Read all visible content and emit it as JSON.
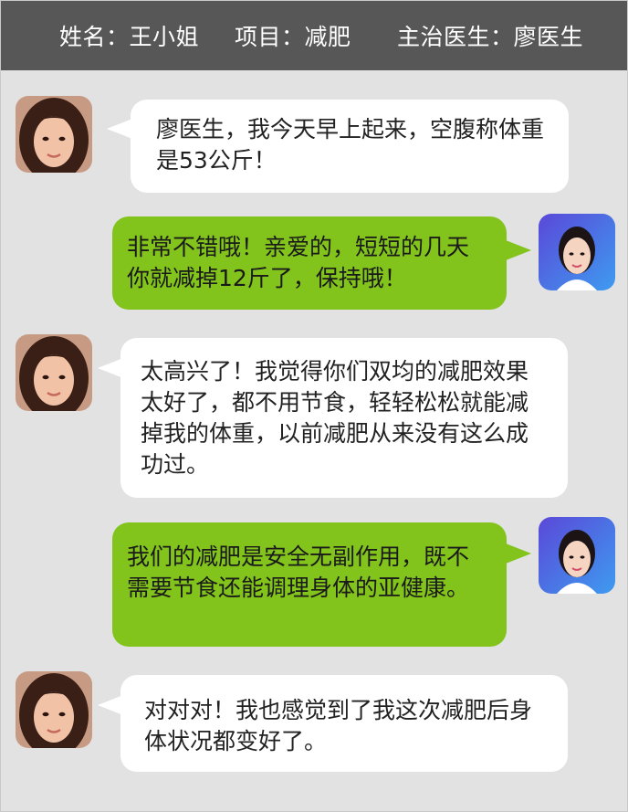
{
  "header": {
    "name": "姓名：王小姐",
    "project": "项目：减肥",
    "doctor": "主治医生：廖医生"
  },
  "messages": [
    {
      "sender": "patient",
      "text": "廖医生，我今天早上起来，空腹称体重是53公斤！"
    },
    {
      "sender": "doctor",
      "text": "非常不错哦！亲爱的，短短的几天你就减掉12斤了，保持哦！"
    },
    {
      "sender": "patient",
      "text": "太高兴了！我觉得你们双均的减肥效果太好了，都不用节食，轻轻松松就能减掉我的体重，以前减肥从来没有这么成功过。"
    },
    {
      "sender": "doctor",
      "text": "我们的减肥是安全无副作用，既不需要节食还能调理身体的亚健康。"
    },
    {
      "sender": "patient",
      "text": "对对对！我也感觉到了我这次减肥后身体状况都变好了。"
    }
  ],
  "colors": {
    "header_bg": "#575757",
    "page_bg": "#e2e2e2",
    "patient_bubble": "#ffffff",
    "doctor_bubble": "#82c31c",
    "doctor_avatar_bg": "#6a55e0"
  }
}
